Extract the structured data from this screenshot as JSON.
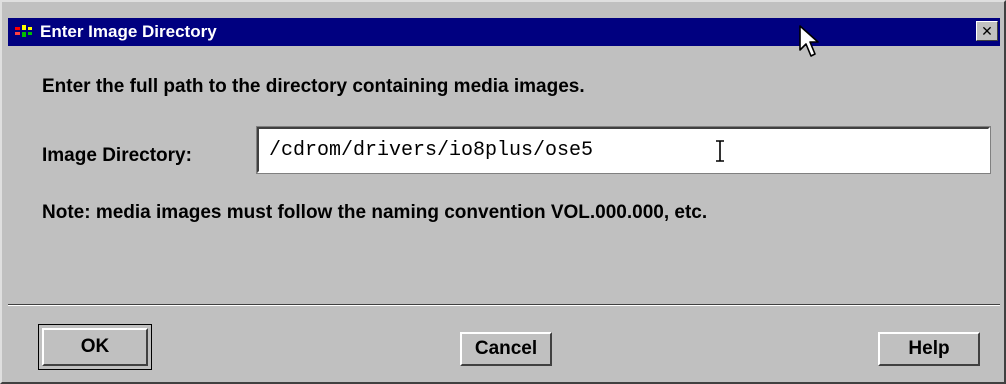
{
  "window": {
    "title": "Enter Image Directory",
    "app_icon": "tri-color-app-icon",
    "close_glyph": "✕"
  },
  "dialog": {
    "prompt": "Enter the full path to the directory containing media images.",
    "directory_label": "Image Directory:",
    "directory_value": "/cdrom/drivers/io8plus/ose5",
    "note": "Note: media images must follow the naming convention VOL.000.000, etc."
  },
  "buttons": {
    "ok": "OK",
    "cancel": "Cancel",
    "help": "Help"
  },
  "colors": {
    "titlebar": "#000080",
    "face": "#c0c0c0"
  }
}
